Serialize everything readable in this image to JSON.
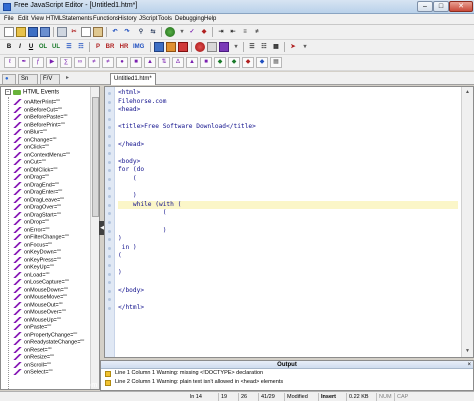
{
  "window": {
    "title": "Free JavaScript Editor  - [Untitled1.htm*]",
    "min_glyph": "–",
    "max_glyph": "□",
    "close_glyph": "✕"
  },
  "menu": [
    "File",
    "Edit",
    "View",
    "HTML",
    "Statements",
    "Functions",
    "History",
    "JScript",
    "Tools",
    "Debugging",
    "Help"
  ],
  "html_toolbar": {
    "buttons": [
      "B",
      "I",
      "U",
      "OL",
      "UL",
      "☰",
      "☶",
      "P",
      "BR",
      "HR",
      "IMG"
    ]
  },
  "panel_tabs": [
    "●",
    "Sn",
    "F/V"
  ],
  "editor": {
    "tab_label": "Untitled1.htm*",
    "code": [
      "<html>",
      "Filehorse.com",
      "<head>",
      "",
      "<title>Free Software Download</title>",
      "",
      "</head>",
      "",
      "<body>",
      "for (do",
      "    (",
      "",
      "    )",
      "    while (with (",
      "            (",
      "",
      "            )",
      ")",
      " in )",
      "(",
      "",
      ")",
      "",
      "</body>",
      "",
      "</html>"
    ],
    "highlighted_line": 13
  },
  "tree": {
    "root_label": "HTML Events",
    "items": [
      "onAfterPrint=\"\"",
      "onBeforeCut=\"\"",
      "onBeforePaste=\"\"",
      "onBeforePrint=\"\"",
      "onBlur=\"\"",
      "onChange=\"\"",
      "onClick=\"\"",
      "onContextMenu=\"\"",
      "onCut=\"\"",
      "onDblClick=\"\"",
      "onDrag=\"\"",
      "onDragEnd=\"\"",
      "onDragEnter=\"\"",
      "onDragLeave=\"\"",
      "onDragOver=\"\"",
      "onDragStart=\"\"",
      "onDrop=\"\"",
      "onError=\"\"",
      "onFilterChange=\"\"",
      "onFocus=\"\"",
      "onKeyDown=\"\"",
      "onKeyPress=\"\"",
      "onKeyUp=\"\"",
      "onLoad=\"\"",
      "onLoseCapture=\"\"",
      "onMouseDown=\"\"",
      "onMouseMove=\"\"",
      "onMouseOut=\"\"",
      "onMouseOver=\"\"",
      "onMouseUp=\"\"",
      "onPaste=\"\"",
      "onPropertyChange=\"\"",
      "onReadystateChange=\"\"",
      "onReset=\"\"",
      "onResize=\"\"",
      "onScroll=\"\"",
      "onSelect=\"\""
    ]
  },
  "output": {
    "header": "Output",
    "close_glyph": "×",
    "lines": [
      "Line 1 Column 1   Warning: missing <!DOCTYPE> declaration",
      "Line 2 Column 1   Warning: plain text isn't allowed in <head> elements"
    ]
  },
  "status": {
    "line": "ln 14",
    "col": "19",
    "chars": "26",
    "pos": "41/29",
    "state": "Modified",
    "mode": "Insert",
    "size": "0.22 KB",
    "num": "NUM",
    "caps": "CAP"
  },
  "watermark": "filehorse.com"
}
